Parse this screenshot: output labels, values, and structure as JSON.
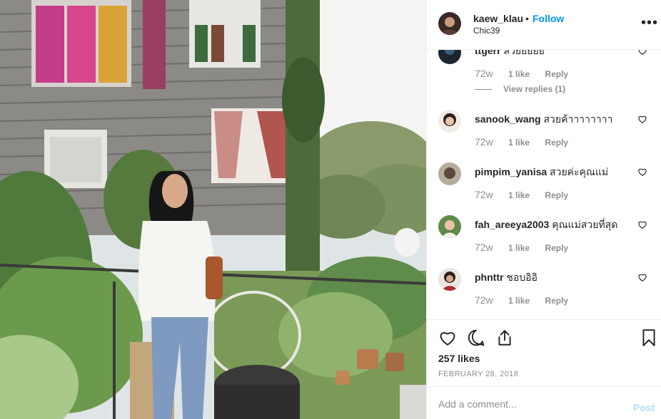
{
  "header": {
    "username": "kaew_klau",
    "separator": "•",
    "follow_label": "Follow",
    "location": "Chic39",
    "more_label": "•••"
  },
  "comments": [
    {
      "username": "ttgerr",
      "text": "สวยยยยย",
      "time": "72w",
      "likes": "1 like",
      "reply": "Reply",
      "view_replies": "View replies (1)"
    },
    {
      "username": "sanook_wang",
      "text": "สวยค้าาาาาาาา",
      "time": "72w",
      "likes": "1 like",
      "reply": "Reply"
    },
    {
      "username": "pimpim_yanisa",
      "text": "สวยค่ะคุณแม่",
      "time": "72w",
      "likes": "1 like",
      "reply": "Reply"
    },
    {
      "username": "fah_areeya2003",
      "text": "คุณแม่สวยที่สุด",
      "time": "72w",
      "likes": "1 like",
      "reply": "Reply"
    },
    {
      "username": "phnttr",
      "text": "ชอบอิอิ",
      "time": "72w",
      "likes": "1 like",
      "reply": "Reply"
    }
  ],
  "post": {
    "likes": "257 likes",
    "date": "FEBRUARY 28, 2018"
  },
  "add_comment": {
    "placeholder": "Add a comment...",
    "post_label": "Post"
  },
  "colors": {
    "accent": "#0095f6",
    "post_disabled": "#b2dffc",
    "muted": "#8e8e8e",
    "text": "#262626"
  },
  "icons": [
    "heart-icon",
    "comment-icon",
    "share-icon",
    "bookmark-icon",
    "more-icon"
  ]
}
